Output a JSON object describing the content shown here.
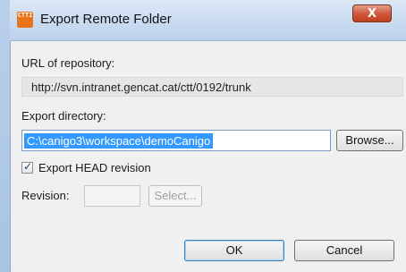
{
  "window": {
    "title": "Export Remote Folder",
    "app_icon_text": "CTTI",
    "close_glyph": "X"
  },
  "repository": {
    "label": "URL of repository:",
    "url": "http://svn.intranet.gencat.cat/ctt/0192/trunk"
  },
  "export_directory": {
    "label": "Export directory:",
    "value": "C:\\canigo3\\workspace\\demoCanigo",
    "browse_label": "Browse..."
  },
  "head_revision": {
    "label": "Export HEAD revision",
    "checked": true
  },
  "revision": {
    "label": "Revision:",
    "value": "",
    "select_label": "Select..."
  },
  "actions": {
    "ok_label": "OK",
    "cancel_label": "Cancel"
  },
  "icons": {
    "app": "ctti-logo-icon",
    "close": "close-icon",
    "check": "checkmark-icon"
  },
  "colors": {
    "selection": "#3399ff",
    "close_button": "#c7472a",
    "dialog_background": "#f0f0f0"
  }
}
